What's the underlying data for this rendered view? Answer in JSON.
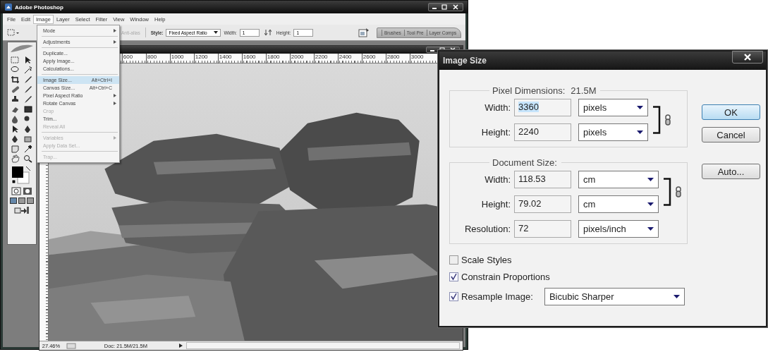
{
  "window": {
    "title": "Adobe Photoshop"
  },
  "menu_bar": [
    {
      "label": "File",
      "selected": false
    },
    {
      "label": "Edit",
      "selected": false
    },
    {
      "label": "Image",
      "selected": true
    },
    {
      "label": "Layer",
      "selected": false
    },
    {
      "label": "Select",
      "selected": false
    },
    {
      "label": "Filter",
      "selected": false
    },
    {
      "label": "View",
      "selected": false
    },
    {
      "label": "Window",
      "selected": false
    },
    {
      "label": "Help",
      "selected": false
    }
  ],
  "options_bar": {
    "anti_alias": "Anti-alias",
    "style_label": "Style:",
    "style_value": "Fixed Aspect Ratio",
    "width_label": "Width:",
    "width_value": "1",
    "height_label": "Height:",
    "height_value": "1",
    "palette_tabs": [
      {
        "label": "Brushes"
      },
      {
        "label": "Tool Pre"
      },
      {
        "label": "Layer Comps"
      }
    ]
  },
  "image_menu": [
    {
      "kind": "item",
      "label": "Mode",
      "submenu": true,
      "disabled": false,
      "selected": false
    },
    {
      "kind": "separator"
    },
    {
      "kind": "item",
      "label": "Adjustments",
      "submenu": true,
      "disabled": false,
      "selected": false
    },
    {
      "kind": "separator"
    },
    {
      "kind": "item",
      "label": "Duplicate...",
      "submenu": false,
      "disabled": false,
      "selected": false
    },
    {
      "kind": "item",
      "label": "Apply Image...",
      "submenu": false,
      "disabled": false,
      "selected": false
    },
    {
      "kind": "item",
      "label": "Calculations...",
      "submenu": false,
      "disabled": false,
      "selected": false
    },
    {
      "kind": "separator"
    },
    {
      "kind": "item",
      "label": "Image Size...",
      "shortcut": "Alt+Ctrl+I",
      "submenu": false,
      "disabled": false,
      "selected": true
    },
    {
      "kind": "item",
      "label": "Canvas Size...",
      "shortcut": "Alt+Ctrl+C",
      "submenu": false,
      "disabled": false,
      "selected": false
    },
    {
      "kind": "item",
      "label": "Pixel Aspect Ratio",
      "submenu": true,
      "disabled": false,
      "selected": false
    },
    {
      "kind": "item",
      "label": "Rotate Canvas",
      "submenu": true,
      "disabled": false,
      "selected": false
    },
    {
      "kind": "item",
      "label": "Crop",
      "submenu": false,
      "disabled": true,
      "selected": false
    },
    {
      "kind": "item",
      "label": "Trim...",
      "submenu": false,
      "disabled": false,
      "selected": false
    },
    {
      "kind": "item",
      "label": "Reveal All",
      "submenu": false,
      "disabled": true,
      "selected": false
    },
    {
      "kind": "separator"
    },
    {
      "kind": "item",
      "label": "Variables",
      "submenu": true,
      "disabled": true,
      "selected": false
    },
    {
      "kind": "item",
      "label": "Apply Data Set...",
      "submenu": false,
      "disabled": true,
      "selected": false
    },
    {
      "kind": "separator"
    },
    {
      "kind": "item",
      "label": "Trap...",
      "submenu": false,
      "disabled": true,
      "selected": false
    }
  ],
  "document": {
    "ruler_labels": [
      "600",
      "800",
      "1000",
      "1200",
      "1400",
      "1600",
      "1800",
      "2000",
      "2200",
      "2400",
      "2600",
      "2800",
      "3000"
    ],
    "zoom": "27.46%",
    "info": "Doc: 21.5M/21.5M"
  },
  "dialog": {
    "title": "Image Size",
    "pixel_dimensions": {
      "legend": "Pixel Dimensions:",
      "size": "21.5M",
      "linked_rows": [
        {
          "label": "Width:",
          "value": "3360",
          "unit": "pixels",
          "highlighted": true
        },
        {
          "label": "Height:",
          "value": "2240",
          "unit": "pixels",
          "highlighted": false
        }
      ]
    },
    "document_size": {
      "legend": "Document Size:",
      "linked_rows": [
        {
          "label": "Width:",
          "value": "118.53",
          "unit": "cm",
          "highlighted": false
        },
        {
          "label": "Height:",
          "value": "79.02",
          "unit": "cm",
          "highlighted": false
        }
      ],
      "rows": [
        {
          "label": "Resolution:",
          "value": "72",
          "unit": "pixels/inch",
          "highlighted": false
        }
      ]
    },
    "options": [
      {
        "label": "Scale Styles",
        "checked": false
      },
      {
        "label": "Constrain Proportions",
        "checked": true
      },
      {
        "label": "Resample Image:",
        "checked": true,
        "select": "Bicubic Sharper"
      }
    ],
    "buttons": [
      {
        "label": "OK",
        "default": true
      },
      {
        "label": "Cancel",
        "default": false
      },
      {
        "label": "Auto...",
        "default": false
      }
    ]
  }
}
